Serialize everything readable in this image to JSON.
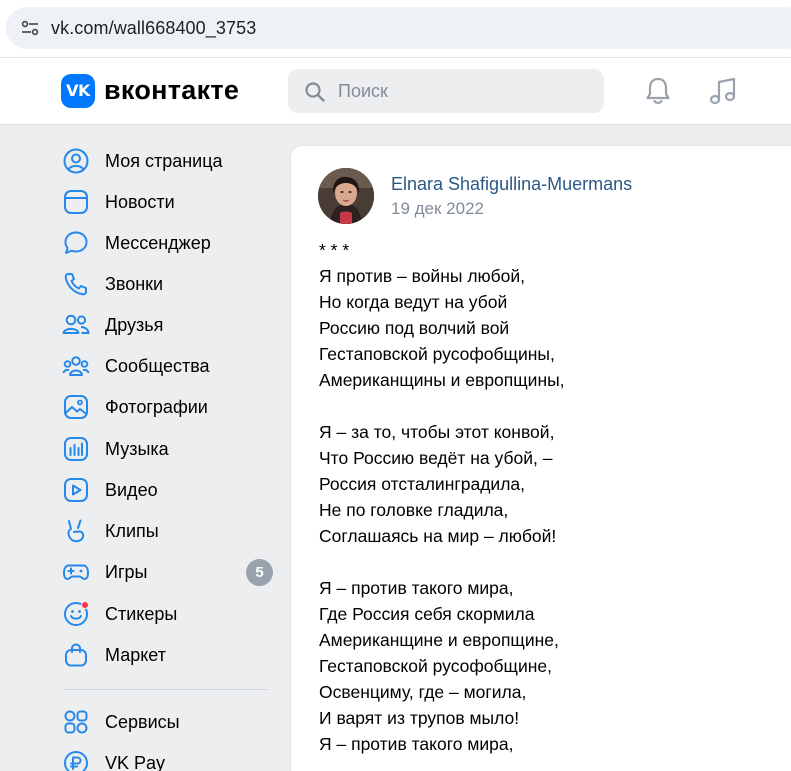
{
  "browser": {
    "url": "vk.com/wall668400_3753"
  },
  "header": {
    "logo_mark": "VK",
    "logo_text": "вконтакте",
    "search_placeholder": "Поиск"
  },
  "sidebar": {
    "items": [
      {
        "label": "Моя страница",
        "icon": "profile-icon"
      },
      {
        "label": "Новости",
        "icon": "news-icon"
      },
      {
        "label": "Мессенджер",
        "icon": "messenger-icon"
      },
      {
        "label": "Звонки",
        "icon": "phone-icon"
      },
      {
        "label": "Друзья",
        "icon": "friends-icon"
      },
      {
        "label": "Сообщества",
        "icon": "communities-icon"
      },
      {
        "label": "Фотографии",
        "icon": "photos-icon"
      },
      {
        "label": "Музыка",
        "icon": "music-app-icon"
      },
      {
        "label": "Видео",
        "icon": "video-icon"
      },
      {
        "label": "Клипы",
        "icon": "clips-icon"
      },
      {
        "label": "Игры",
        "icon": "games-icon",
        "badge": "5"
      },
      {
        "label": "Стикеры",
        "icon": "stickers-icon"
      },
      {
        "label": "Маркет",
        "icon": "market-icon"
      },
      {
        "label": "Сервисы",
        "icon": "services-icon"
      },
      {
        "label": "VK Pay",
        "icon": "vkpay-icon"
      }
    ]
  },
  "post": {
    "author": "Elnara Shafigullina-Muermans",
    "date": "19 дек 2022",
    "lines": [
      "* * *",
      "Я против – войны любой,",
      "Но когда ведут на убой",
      "Россию под волчий вой",
      "Гестаповской русофобщины,",
      "Американщины и европщины,",
      "",
      "Я – за то, чтобы этот конвой,",
      "Что Россию ведёт на убой, –",
      "Россия отсталинградила,",
      "Не по головке гладила,",
      "Соглашаясь на мир – любой!",
      "",
      "Я – против такого мира,",
      "Где Россия себя скормила",
      "Американщине и европщине,",
      "Гестаповской русофобщине,",
      "Освенциму, где – могила,",
      "И варят из трупов мыло!",
      "Я – против такого мира,"
    ]
  },
  "colors": {
    "accent": "#0077ff",
    "link": "#2a5885",
    "icon": "#2688eb",
    "background": "#edeef0",
    "badge": "#99a2ad"
  }
}
